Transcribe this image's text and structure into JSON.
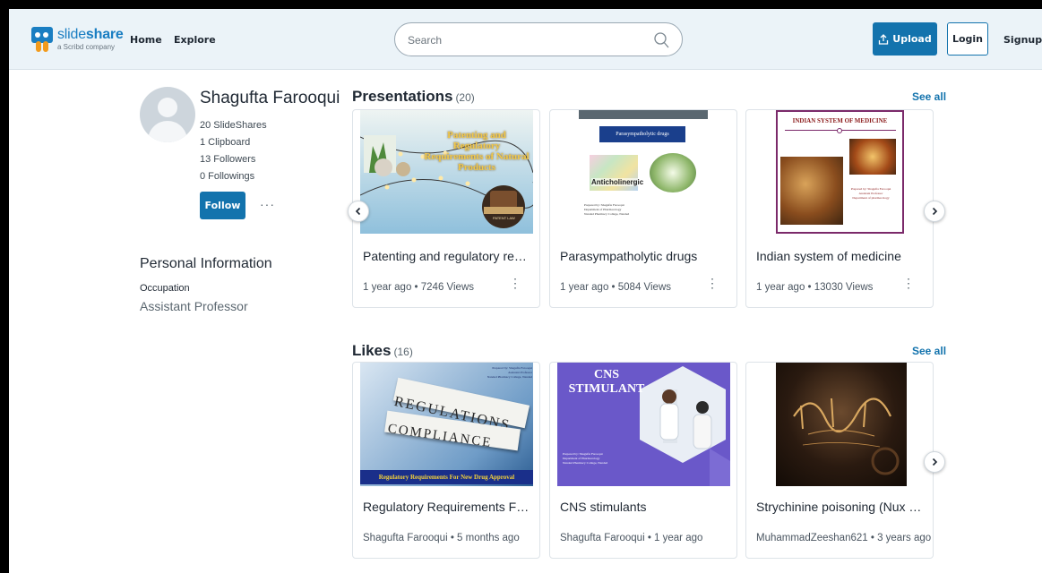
{
  "header": {
    "logo_name_light": "slide",
    "logo_name_bold": "share",
    "logo_sub": "a Scribd company",
    "nav": [
      "Home",
      "Explore"
    ],
    "search_placeholder": "Search",
    "upload_label": "Upload",
    "login_label": "Login",
    "signup_label": "Signup"
  },
  "profile": {
    "name": "Shagufta Farooqui",
    "stats": [
      "20 SlideShares",
      "1 Clipboard",
      "13 Followers",
      "0 Followings"
    ],
    "follow_label": "Follow",
    "more_label": "···",
    "personal_info_title": "Personal Information",
    "occupation_label": "Occupation",
    "occupation_value": "Assistant Professor"
  },
  "presentations": {
    "title": "Presentations",
    "count": "(20)",
    "see_all": "See all",
    "cards": [
      {
        "title": "Patenting and regulatory requi...",
        "meta": "1 year ago • 7246 Views",
        "thumb_text": [
          "Patenting and",
          "Regulatory",
          "Requirements of Natural",
          "Products"
        ],
        "thumb_badge": "PATENT LAW"
      },
      {
        "title": "Parasympatholytic drugs",
        "meta": "1 year ago • 5084 Views",
        "thumb_text": [
          "Parasympatholytic drugs"
        ],
        "thumb_label": "Anticholinergic",
        "thumb_credit": [
          "Prepared by: Shagufta Farooqui",
          "Department of Pharmacology",
          "Nanded Pharmacy College, Nanded"
        ]
      },
      {
        "title": "Indian system of medicine",
        "meta": "1 year ago • 13030 Views",
        "thumb_text": [
          "INDIAN SYSTEM OF MEDICINE"
        ],
        "thumb_credit": [
          "Prepared by: Shagufta Farooqui",
          "Assistant Professor",
          "Department of pharmacology"
        ]
      }
    ]
  },
  "likes": {
    "title": "Likes",
    "count": "(16)",
    "see_all": "See all",
    "cards": [
      {
        "title": "Regulatory Requirements For ...",
        "meta": "Shagufta Farooqui • 5 months ago",
        "thumb_words": [
          "REGULATIONS",
          "COMPLIANCE"
        ],
        "thumb_banner": "Regulatory Requirements For New Drug Approval",
        "thumb_credit": [
          "Prepared by: Shagufta Farooqui",
          "Assistant Professor",
          "Nanded Pharmacy College, Nanded"
        ]
      },
      {
        "title": "CNS stimulants",
        "meta": "Shagufta Farooqui • 1 year ago",
        "thumb_text": [
          "CNS",
          "STIMULANT"
        ],
        "thumb_credit": [
          "Prepared by: Shagufta Farooqui",
          "Department of Pharmacology",
          "Nanded Pharmacy College, Nanded"
        ]
      },
      {
        "title": "Strychinine poisoning (Nux vo...",
        "meta": "MuhammadZeeshan621 • 3 years ago"
      }
    ]
  },
  "colors": {
    "brand": "#1373ad",
    "header_bg": "#ebf3f8",
    "text": "#1f2833"
  }
}
